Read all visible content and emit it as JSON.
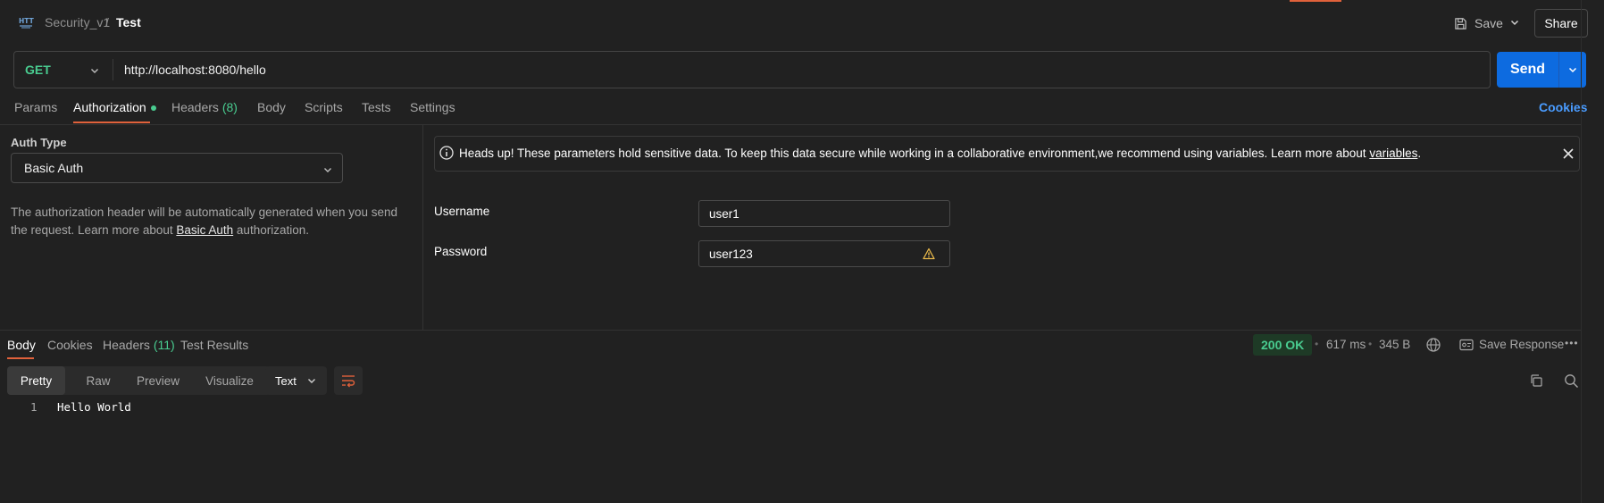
{
  "colors": {
    "accent": "#e0613b",
    "send": "#0d6be0",
    "method_get": "#49cc90",
    "status_ok": "#49cc90",
    "link": "#4a9cff"
  },
  "header": {
    "icon": "http-icon",
    "breadcrumb_parent": "Security_v1",
    "breadcrumb_separator": "/",
    "breadcrumb_current": "Test",
    "save_label": "Save",
    "share_label": "Share"
  },
  "request": {
    "method": "GET",
    "url": "http://localhost:8080/hello",
    "send_label": "Send"
  },
  "request_tabs": [
    {
      "label": "Params"
    },
    {
      "label": "Authorization",
      "active": true
    },
    {
      "label": "Headers",
      "count": "(8)"
    },
    {
      "label": "Body"
    },
    {
      "label": "Scripts"
    },
    {
      "label": "Tests"
    },
    {
      "label": "Settings"
    }
  ],
  "cookies_label": "Cookies",
  "auth": {
    "type_label": "Auth Type",
    "type_value": "Basic Auth",
    "desc_before": "The authorization header will be automatically generated when you send the request. Learn more about ",
    "desc_link": "Basic Auth",
    "desc_after": " authorization.",
    "banner_text": "Heads up! These parameters hold sensitive data. To keep this data secure while working in a collaborative environment,we recommend using variables. Learn more about ",
    "banner_link": "variables",
    "banner_end": ".",
    "username_label": "Username",
    "username_value": "user1",
    "password_label": "Password",
    "password_value": "user123"
  },
  "response_tabs": [
    {
      "label": "Body",
      "active": true
    },
    {
      "label": "Cookies"
    },
    {
      "label": "Headers",
      "count": "(11)"
    },
    {
      "label": "Test Results"
    }
  ],
  "response": {
    "status": "200 OK",
    "time": "617 ms",
    "size": "345 B",
    "save_response_label": "Save Response",
    "more_label": "•••",
    "view_modes": [
      "Pretty",
      "Raw",
      "Preview",
      "Visualize"
    ],
    "format": "Text",
    "line_number": "1",
    "body_line": "Hello World"
  }
}
